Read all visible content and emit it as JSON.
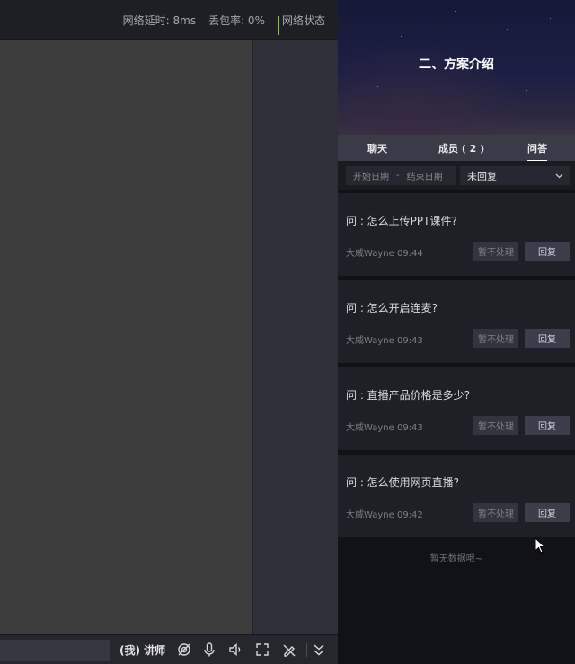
{
  "network": {
    "latency": "网络延时: 8ms",
    "packet_loss": "丢包率: 0%",
    "status_label": "网络状态"
  },
  "toolbar": {
    "role_label": "(我) 讲师",
    "icons": [
      "camera-off-icon",
      "microphone-icon",
      "speaker-icon",
      "fullscreen-icon",
      "pen-off-icon",
      "collapse-icon"
    ]
  },
  "banner": {
    "title": "二、方案介绍"
  },
  "tabs": [
    {
      "label": "聊天"
    },
    {
      "label": "成员 ( 2 )"
    },
    {
      "label": "问答",
      "active": true
    }
  ],
  "filters": {
    "start_date": "开始日期",
    "separator": "-",
    "end_date": "结束日期",
    "status_select": "未回复"
  },
  "questions": [
    {
      "text": "问 : 怎么上传PPT课件?",
      "meta": "大威Wayne 09:44",
      "ignore_label": "暂不处理",
      "reply_label": "回复"
    },
    {
      "text": "问 : 怎么开启连麦?",
      "meta": "大威Wayne 09:43",
      "ignore_label": "暂不处理",
      "reply_label": "回复"
    },
    {
      "text": "问 : 直播产品价格是多少?",
      "meta": "大威Wayne 09:43",
      "ignore_label": "暂不处理",
      "reply_label": "回复"
    },
    {
      "text": "问 : 怎么使用网页直播?",
      "meta": "大威Wayne 09:42",
      "ignore_label": "暂不处理",
      "reply_label": "回复"
    }
  ],
  "empty_text": "暂无数据哦~",
  "colors": {
    "signal": "#8cc63f",
    "panel_bg": "#111217",
    "card_bg": "#1f2027",
    "tab_bar": "#3a3b46",
    "stage_bg": "#3c3c3c"
  }
}
